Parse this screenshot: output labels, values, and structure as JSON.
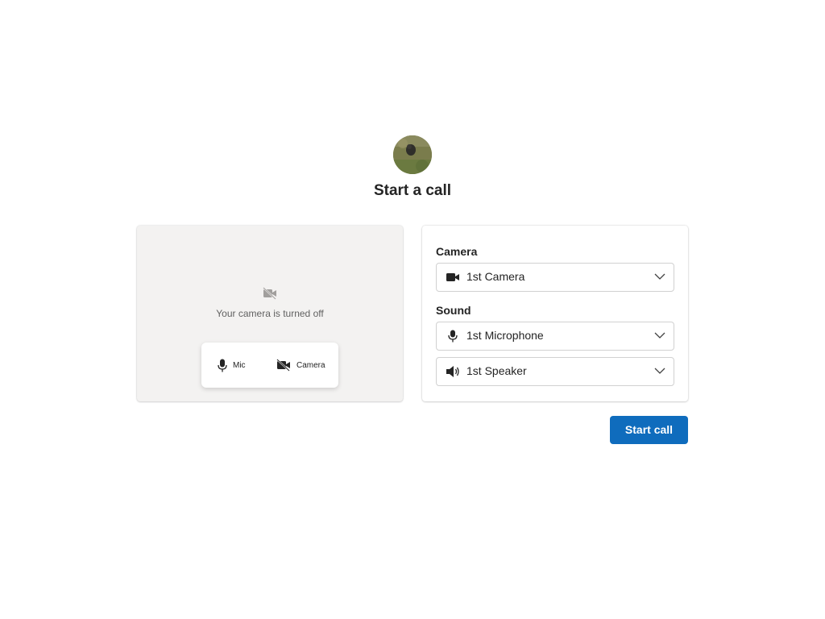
{
  "header": {
    "title": "Start a call",
    "avatar_icon": "user-avatar-photo"
  },
  "preview": {
    "camera_off_text": "Your camera is turned off",
    "camera_off_icon": "video-off-icon",
    "mic_toggle_label": "Mic",
    "camera_toggle_label": "Camera"
  },
  "settings": {
    "camera_section_label": "Camera",
    "camera_selected": "1st Camera",
    "sound_section_label": "Sound",
    "microphone_selected": "1st Microphone",
    "speaker_selected": "1st Speaker"
  },
  "actions": {
    "start_call_label": "Start call"
  },
  "colors": {
    "accent": "#0f6cbd",
    "preview_background": "#f3f2f1"
  }
}
